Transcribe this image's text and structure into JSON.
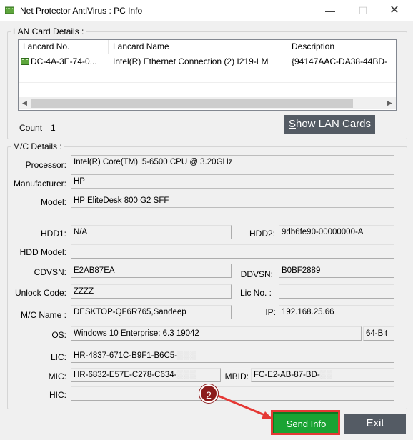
{
  "window": {
    "title": "Net Protector AntiVirus : PC Info",
    "minimize": "—",
    "maximize": "☐",
    "close": "✕"
  },
  "lan": {
    "legend": "LAN Card Details :",
    "columns": [
      "Lancard No.",
      "Lancard Name",
      "Description"
    ],
    "rows": [
      {
        "no": "DC-4A-3E-74-0...",
        "name": "Intel(R) Ethernet Connection (2) I219-LM",
        "description": "{94147AAC-DA38-44BD-"
      }
    ],
    "count_label": "Count",
    "count_value": "1",
    "show_button_prefix": "S",
    "show_button_rest": "how LAN Cards"
  },
  "mc": {
    "legend": "M/C Details :",
    "processor_label": "Processor:",
    "processor": "Intel(R) Core(TM) i5-6500 CPU @ 3.20GHz",
    "manufacturer_label": "Manufacturer:",
    "manufacturer": "HP",
    "model_label": "Model:",
    "model": "HP EliteDesk 800 G2 SFF",
    "hdd1_label": "HDD1:",
    "hdd1": "N/A",
    "hdd2_label": "HDD2:",
    "hdd2": "9db6fe90-00000000-A",
    "hdd_model_label": "HDD Model:",
    "hdd_model": "",
    "cdvsn_label": "CDVSN:",
    "cdvsn": "E2AB87EA",
    "ddvsn_label": "DDVSN:",
    "ddvsn": "B0BF2889",
    "unlock_label": "Unlock Code:",
    "unlock": "ZZZZ",
    "lic_no_label": "Lic No. :",
    "lic_no": "",
    "mc_name_label": "M/C Name :",
    "mc_name": "DESKTOP-QF6R765,Sandeep",
    "ip_label": "IP:",
    "ip": "192.168.25.66",
    "os_label": "OS:",
    "os": "Windows 10 Enterprise: 6.3 19042",
    "arch": "64-Bit",
    "lic_label": "LIC:",
    "lic": "HR-4837-671C-B9F1-B6C5-",
    "mic_label": "MIC:",
    "mic": "HR-6832-E57E-C278-C634-",
    "mbid_label": "MBID:",
    "mbid": "FC-E2-AB-87-BD-",
    "hic_label": "HIC:",
    "hic": ""
  },
  "buttons": {
    "send": "Send Info",
    "exit": "Exit"
  },
  "annotation": {
    "step": "2",
    "color": "#e53935",
    "badge_color": "#8c1c1c"
  }
}
